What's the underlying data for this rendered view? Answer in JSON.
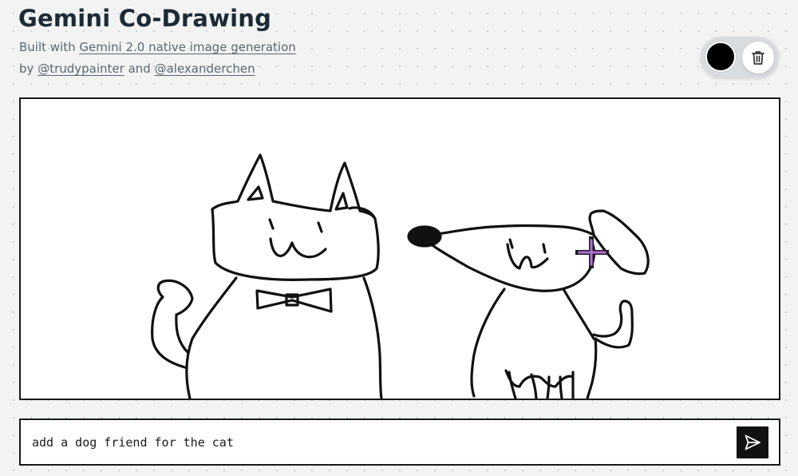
{
  "app": {
    "title": "Gemini Co-Drawing"
  },
  "credits": {
    "built_with_prefix": "Built with",
    "built_with_link": "Gemini 2.0 native image generation",
    "by_prefix": "by",
    "author1": "@trudypainter",
    "and_text": "and",
    "author2": "@alexanderchen"
  },
  "toolbar": {
    "pen_color": "#000000",
    "pen_color_icon": "color-swatch",
    "clear_icon": "trash-icon"
  },
  "canvas": {
    "background": "#ffffff",
    "drawing_subjects": [
      "cat",
      "dog"
    ],
    "cursor_icon": "crosshair-cursor",
    "cursor_color": "#a259c4"
  },
  "prompt": {
    "value": "add a dog friend for the cat",
    "send_icon": "send-icon"
  }
}
